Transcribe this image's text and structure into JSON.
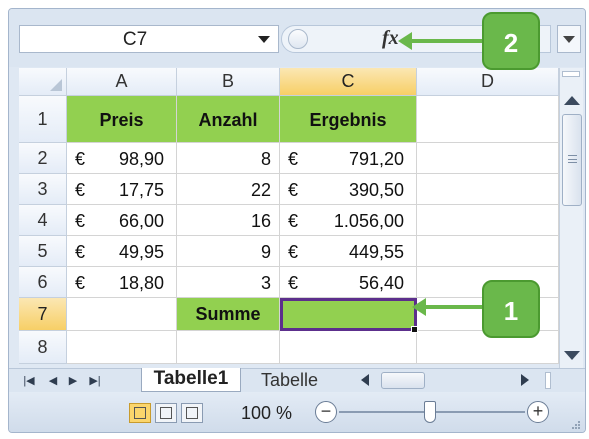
{
  "formula_bar": {
    "name_box": "C7",
    "fx_label": "fx"
  },
  "columns": [
    "A",
    "B",
    "C",
    "D"
  ],
  "rows": [
    "1",
    "2",
    "3",
    "4",
    "5",
    "6",
    "7",
    "8"
  ],
  "selected": {
    "cell": "C7",
    "column": "C",
    "row": "7"
  },
  "cells": {
    "header": {
      "a": "Preis",
      "b": "Anzahl",
      "c": "Ergebnis"
    },
    "data": [
      {
        "a_cur": "€",
        "a_num": "98,90",
        "b": "8",
        "c_cur": "€",
        "c_num": "791,20"
      },
      {
        "a_cur": "€",
        "a_num": "17,75",
        "b": "22",
        "c_cur": "€",
        "c_num": "390,50"
      },
      {
        "a_cur": "€",
        "a_num": "66,00",
        "b": "16",
        "c_cur": "€",
        "c_num": "1.056,00"
      },
      {
        "a_cur": "€",
        "a_num": "49,95",
        "b": "9",
        "c_cur": "€",
        "c_num": "449,55"
      },
      {
        "a_cur": "€",
        "a_num": "18,80",
        "b": "3",
        "c_cur": "€",
        "c_num": "56,40"
      }
    ],
    "sum_label": "Summe",
    "sum_value": ""
  },
  "sheet_tabs": {
    "active": "Tabelle1",
    "inactive": "Tabelle"
  },
  "status_bar": {
    "zoom": "100 %",
    "zoom_level_percent": 100,
    "minus": "−",
    "plus": "+"
  },
  "callouts": [
    {
      "number": "2",
      "points_to": "fx-button"
    },
    {
      "number": "1",
      "points_to": "cell-C7"
    }
  ],
  "colors": {
    "header_fill": "#92d050",
    "selection_border": "#5c2f8c",
    "callout": "#6ab84b",
    "selected_header": "#f7cf66"
  }
}
